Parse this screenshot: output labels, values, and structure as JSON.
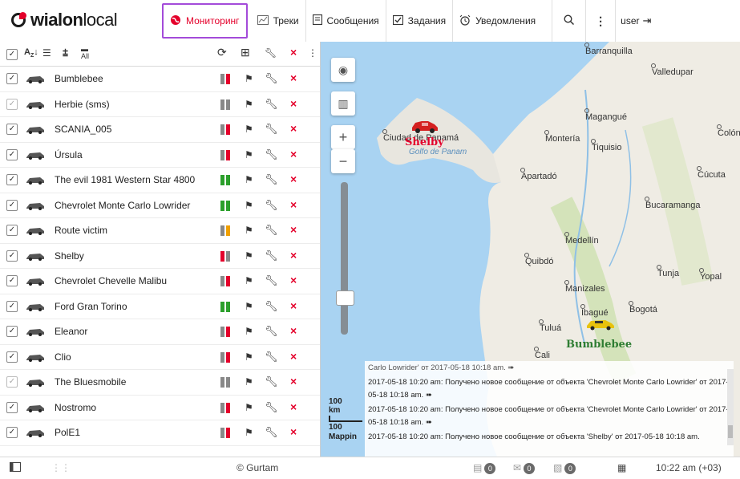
{
  "logo": {
    "wialon": "wialon",
    "local": "local"
  },
  "nav": {
    "monitoring": "Мониторинг",
    "tracks": "Треки",
    "messages": "Сообщения",
    "tasks": "Задания",
    "notifications": "Уведомления",
    "user": "user"
  },
  "units": [
    {
      "name": "Bumblebee",
      "checked": true,
      "status": [
        "#888",
        "#e4002b"
      ]
    },
    {
      "name": "Herbie (sms)",
      "checked": true,
      "dim": true,
      "status": [
        "#888",
        "#888"
      ]
    },
    {
      "name": "SCANIA_005",
      "checked": true,
      "status": [
        "#888",
        "#e4002b"
      ]
    },
    {
      "name": "Úrsula",
      "checked": true,
      "status": [
        "#888",
        "#e4002b"
      ]
    },
    {
      "name": "The evil 1981 Western Star 4800",
      "checked": true,
      "status": [
        "#2ca02c",
        "#2ca02c"
      ]
    },
    {
      "name": "Chevrolet Monte Carlo Lowrider",
      "checked": true,
      "status": [
        "#2ca02c",
        "#2ca02c"
      ]
    },
    {
      "name": "Route victim",
      "checked": true,
      "status": [
        "#888",
        "#f0a000"
      ]
    },
    {
      "name": "Shelby",
      "checked": true,
      "status": [
        "#e4002b",
        "#888"
      ]
    },
    {
      "name": "Chevrolet Chevelle Malibu",
      "checked": true,
      "status": [
        "#888",
        "#e4002b"
      ]
    },
    {
      "name": "Ford Gran Torino",
      "checked": true,
      "status": [
        "#2ca02c",
        "#2ca02c"
      ]
    },
    {
      "name": "Eleanor",
      "checked": true,
      "status": [
        "#888",
        "#e4002b"
      ]
    },
    {
      "name": "Clio",
      "checked": true,
      "status": [
        "#888",
        "#e4002b"
      ]
    },
    {
      "name": "The Bluesmobile",
      "checked": true,
      "dim": true,
      "status": [
        "#888",
        "#888"
      ]
    },
    {
      "name": "Nostromo",
      "checked": true,
      "status": [
        "#888",
        "#e4002b"
      ]
    },
    {
      "name": "PolE1",
      "checked": true,
      "status": [
        "#888",
        "#e4002b"
      ]
    }
  ],
  "map": {
    "cities": [
      {
        "name": "Barranquilla"
      },
      {
        "name": "Valledupar"
      },
      {
        "name": "Ciudad de Panamá"
      },
      {
        "name": "Magangué"
      },
      {
        "name": "Colón"
      },
      {
        "name": "Montería"
      },
      {
        "name": "Tiquisio"
      },
      {
        "name": "Apartadó"
      },
      {
        "name": "Cúcuta"
      },
      {
        "name": "Bucaramanga"
      },
      {
        "name": "Medellín"
      },
      {
        "name": "Quibdó"
      },
      {
        "name": "Tunja"
      },
      {
        "name": "Yopal"
      },
      {
        "name": "Manizales"
      },
      {
        "name": "Ibagué"
      },
      {
        "name": "Bogotá"
      },
      {
        "name": "Tuluá"
      },
      {
        "name": "Cali"
      }
    ],
    "sea": "Golfo de Panam",
    "car_labels": {
      "shelby": "Shelby",
      "bumblebee": "Bumblebee"
    },
    "scale": {
      "value": "100",
      "unit": "km"
    },
    "scale2": {
      "value": "100"
    },
    "mapping": "Mappin",
    "log": [
      "Carlo Lowrider' от 2017-05-18 10:18 am. ➠",
      "2017-05-18 10:20 am: Получено новое сообщение от объекта 'Chevrolet Monte Carlo Lowrider' от 2017-05-18 10:18 am. ➠",
      "2017-05-18 10:20 am: Получено новое сообщение от объекта 'Chevrolet Monte Carlo Lowrider' от 2017-05-18 10:18 am. ➠",
      "2017-05-18 10:20 am: Получено новое сообщение от объекта 'Shelby' от 2017-05-18 10:18 am."
    ]
  },
  "footer": {
    "copyright": "© Gurtam",
    "counter1": "0",
    "counter2": "0",
    "counter3": "0",
    "time": "10:22 am (+03)"
  }
}
